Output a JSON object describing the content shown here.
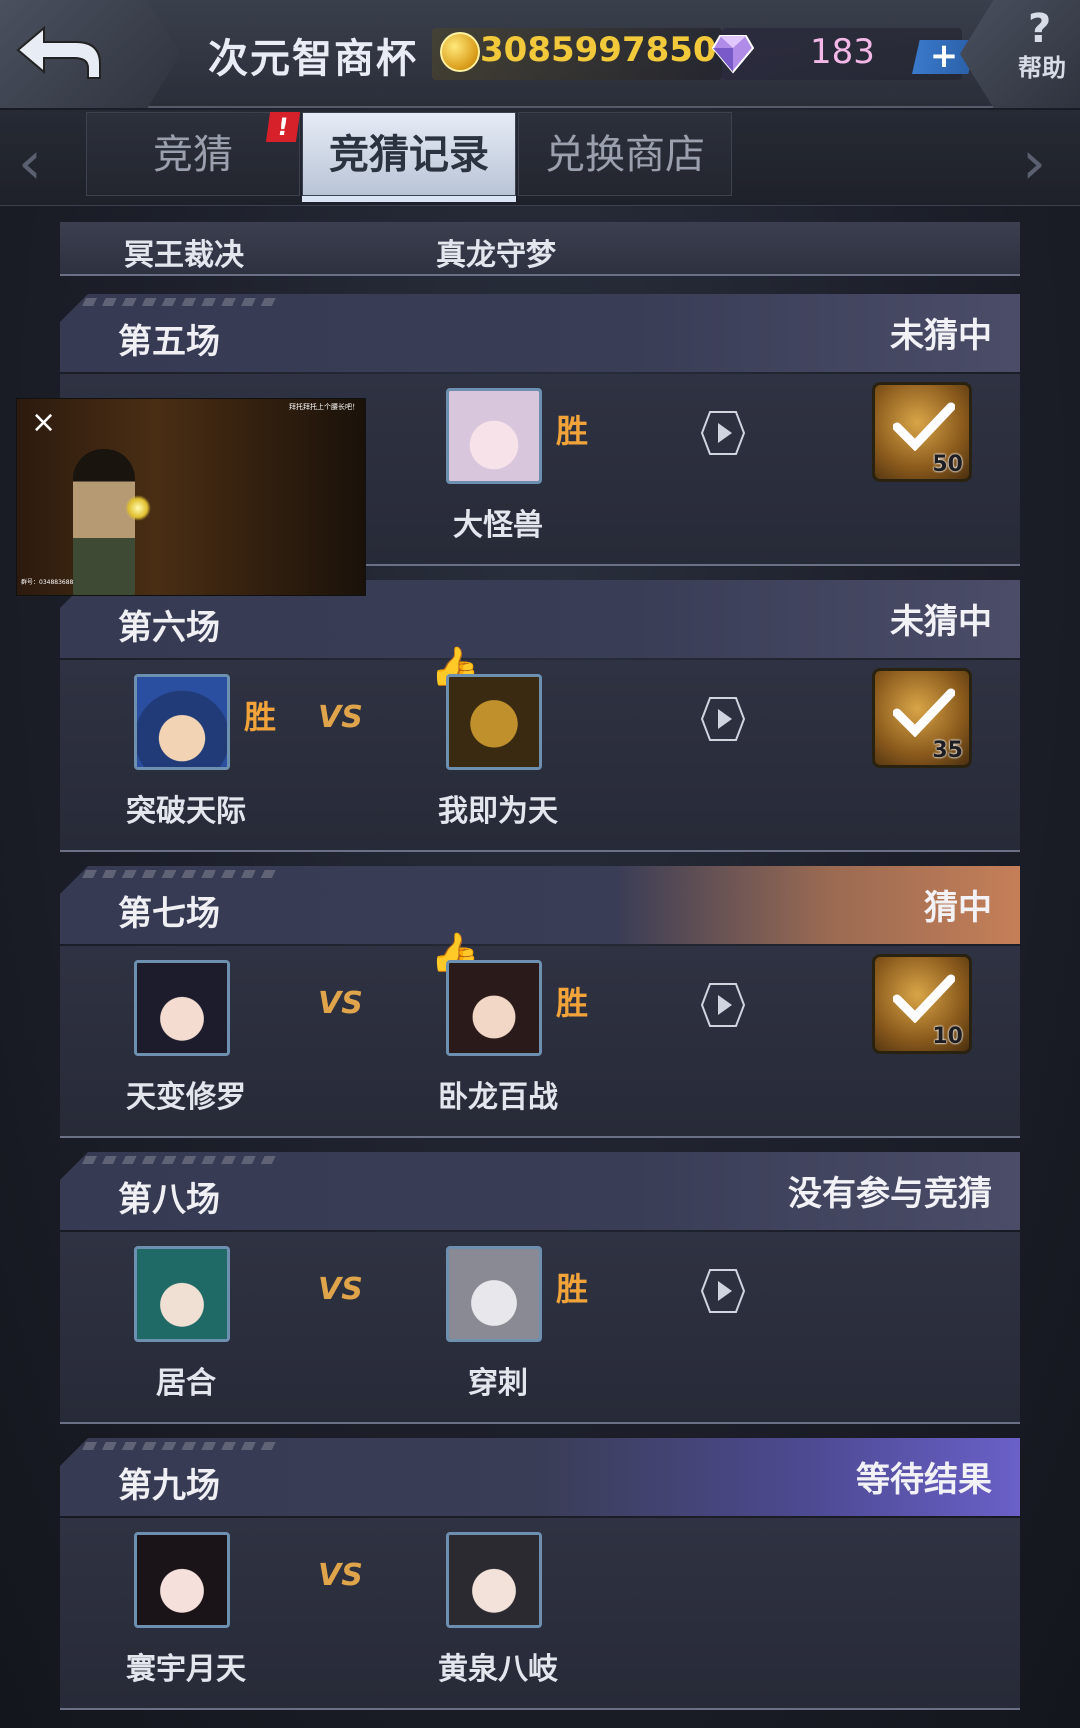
{
  "header": {
    "title": "次元智商杯",
    "coins": "3085997850",
    "gems": "183",
    "plus_label": "+",
    "help_label": "帮助",
    "help_symbol": "?"
  },
  "tabs": [
    {
      "label": "竞猜",
      "badge": "!"
    },
    {
      "label": "竞猜记录",
      "active": true
    },
    {
      "label": "兑换商店"
    }
  ],
  "partial_row": {
    "left": "冥王裁决",
    "right": "真龙守梦"
  },
  "matches": [
    {
      "round": "第五场",
      "status": "未猜中",
      "right": {
        "name": "大怪兽"
      },
      "winner_mark": "胜",
      "reward_count": "50"
    },
    {
      "round": "第六场",
      "status": "未猜中",
      "left": {
        "name": "突破天际"
      },
      "right": {
        "name": "我即为天"
      },
      "winner_mark": "胜",
      "vs": "VS",
      "reward_count": "35"
    },
    {
      "round": "第七场",
      "status": "猜中",
      "left": {
        "name": "天变修罗"
      },
      "right": {
        "name": "卧龙百战"
      },
      "winner_mark": "胜",
      "vs": "VS",
      "reward_count": "10"
    },
    {
      "round": "第八场",
      "status": "没有参与竞猜",
      "left": {
        "name": "居合"
      },
      "right": {
        "name": "穿刺"
      },
      "winner_mark": "胜",
      "vs": "VS"
    },
    {
      "round": "第九场",
      "status": "等待结果",
      "left": {
        "name": "寰宇月天"
      },
      "right": {
        "name": "黄泉八岐"
      },
      "vs": "VS"
    }
  ],
  "video_overlay": {
    "close_label": "×",
    "caption_top": "拜托拜托上个腰长吧！",
    "caption_bottom": "群号：034883688"
  },
  "colors": {
    "accent_gold": "#f2c93a",
    "win_orange": "#f2a43a",
    "gem_pink": "#f4b8e8",
    "badge_red": "#d6202a"
  },
  "icons": {
    "back": "back-arrow-icon",
    "coin": "gold-coin-icon",
    "gem": "diamond-gem-icon",
    "play": "play-icon",
    "thumb": "thumbs-up-icon",
    "reward": "coin-check-reward-icon"
  }
}
